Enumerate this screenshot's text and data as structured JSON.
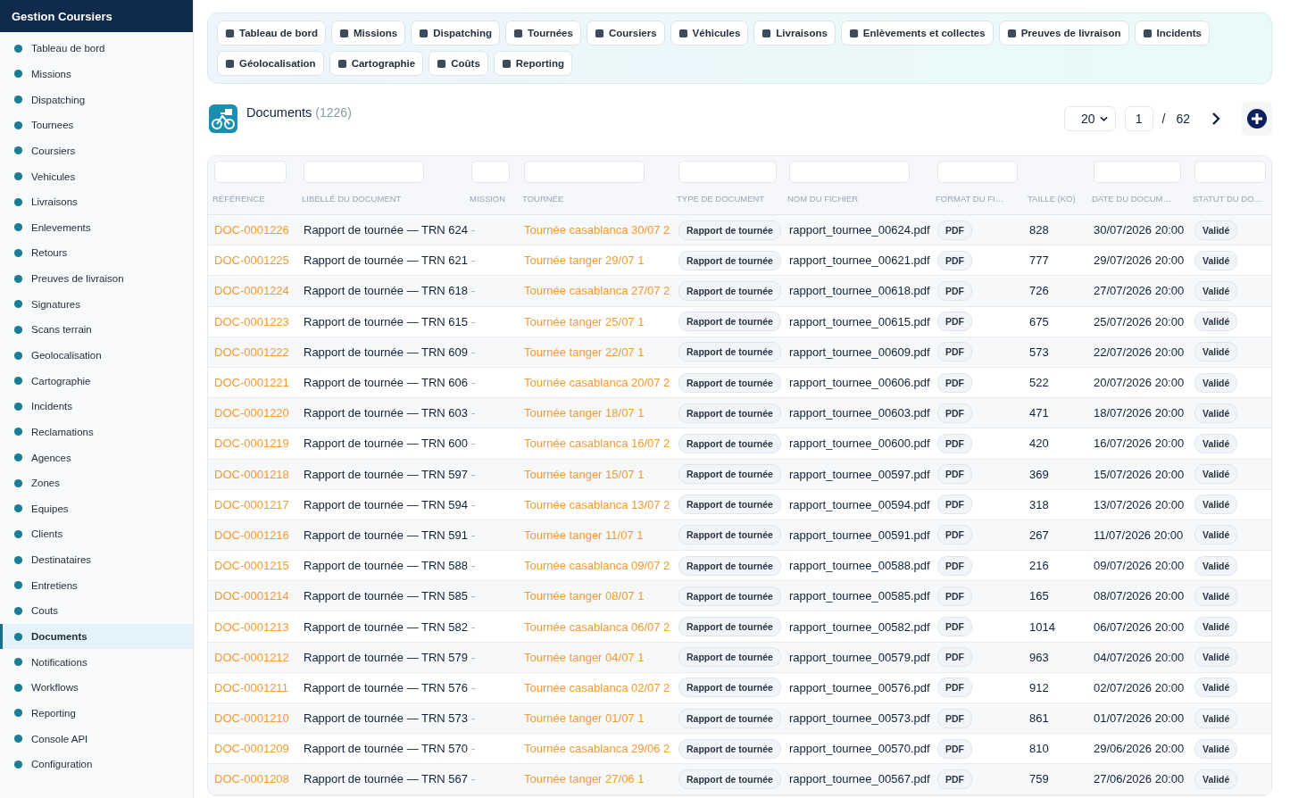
{
  "sidebar": {
    "title": "Gestion Coursiers",
    "items": [
      {
        "label": "Tableau de bord",
        "selected": false
      },
      {
        "label": "Missions",
        "selected": false
      },
      {
        "label": "Dispatching",
        "selected": false
      },
      {
        "label": "Tournees",
        "selected": false
      },
      {
        "label": "Coursiers",
        "selected": false
      },
      {
        "label": "Vehicules",
        "selected": false
      },
      {
        "label": "Livraisons",
        "selected": false
      },
      {
        "label": "Enlevements",
        "selected": false
      },
      {
        "label": "Retours",
        "selected": false
      },
      {
        "label": "Preuves de livraison",
        "selected": false
      },
      {
        "label": "Signatures",
        "selected": false
      },
      {
        "label": "Scans terrain",
        "selected": false
      },
      {
        "label": "Geolocalisation",
        "selected": false
      },
      {
        "label": "Cartographie",
        "selected": false
      },
      {
        "label": "Incidents",
        "selected": false
      },
      {
        "label": "Reclamations",
        "selected": false
      },
      {
        "label": "Agences",
        "selected": false
      },
      {
        "label": "Zones",
        "selected": false
      },
      {
        "label": "Equipes",
        "selected": false
      },
      {
        "label": "Clients",
        "selected": false
      },
      {
        "label": "Destinataires",
        "selected": false
      },
      {
        "label": "Entretiens",
        "selected": false
      },
      {
        "label": "Couts",
        "selected": false
      },
      {
        "label": "Documents",
        "selected": true
      },
      {
        "label": "Notifications",
        "selected": false
      },
      {
        "label": "Workflows",
        "selected": false
      },
      {
        "label": "Reporting",
        "selected": false
      },
      {
        "label": "Console API",
        "selected": false
      },
      {
        "label": "Configuration",
        "selected": false
      }
    ]
  },
  "quick_links": [
    "Tableau de bord",
    "Missions",
    "Dispatching",
    "Tournées",
    "Coursiers",
    "Véhicules",
    "Livraisons",
    "Enlèvements et collectes",
    "Preuves de livraison",
    "Incidents",
    "Géolocalisation",
    "Cartographie",
    "Coûts",
    "Reporting"
  ],
  "header": {
    "title": "Documents",
    "count": "(1226)",
    "page_size": "20",
    "page": "1",
    "separator": "/",
    "page_count": "62"
  },
  "table": {
    "columns": [
      {
        "label": "RÉFÉRENCE",
        "filter": true,
        "kind": "link"
      },
      {
        "label": "LIBELLÉ DU DOCUMENT",
        "filter": true,
        "kind": "text"
      },
      {
        "label": "MISSION",
        "filter": true,
        "kind": "muted"
      },
      {
        "label": "TOURNÉE",
        "filter": true,
        "kind": "link"
      },
      {
        "label": "TYPE DE DOCUMENT",
        "filter": true,
        "kind": "chip"
      },
      {
        "label": "NOM DU FICHIER",
        "filter": true,
        "kind": "text"
      },
      {
        "label": "FORMAT DU FI…",
        "filter": true,
        "kind": "chip"
      },
      {
        "label": "TAILLE (KO)",
        "filter": false,
        "kind": "text"
      },
      {
        "label": "DATE DU DOCUM…",
        "filter": true,
        "kind": "text"
      },
      {
        "label": "STATUT DU DO…",
        "filter": true,
        "kind": "chip"
      }
    ],
    "rows": [
      [
        "DOC-0001226",
        "Rapport de tournée — TRN 624",
        "-",
        "Tournée casablanca 30/07 2",
        "Rapport de tournée",
        "rapport_tournee_00624.pdf",
        "PDF",
        "828",
        "30/07/2026 20:00",
        "Validé"
      ],
      [
        "DOC-0001225",
        "Rapport de tournée — TRN 621",
        "-",
        "Tournée tanger 29/07 1",
        "Rapport de tournée",
        "rapport_tournee_00621.pdf",
        "PDF",
        "777",
        "29/07/2026 20:00",
        "Validé"
      ],
      [
        "DOC-0001224",
        "Rapport de tournée — TRN 618",
        "-",
        "Tournée casablanca 27/07 2",
        "Rapport de tournée",
        "rapport_tournee_00618.pdf",
        "PDF",
        "726",
        "27/07/2026 20:00",
        "Validé"
      ],
      [
        "DOC-0001223",
        "Rapport de tournée — TRN 615",
        "-",
        "Tournée tanger 25/07 1",
        "Rapport de tournée",
        "rapport_tournee_00615.pdf",
        "PDF",
        "675",
        "25/07/2026 20:00",
        "Validé"
      ],
      [
        "DOC-0001222",
        "Rapport de tournée — TRN 609",
        "-",
        "Tournée tanger 22/07 1",
        "Rapport de tournée",
        "rapport_tournee_00609.pdf",
        "PDF",
        "573",
        "22/07/2026 20:00",
        "Validé"
      ],
      [
        "DOC-0001221",
        "Rapport de tournée — TRN 606",
        "-",
        "Tournée casablanca 20/07 2",
        "Rapport de tournée",
        "rapport_tournee_00606.pdf",
        "PDF",
        "522",
        "20/07/2026 20:00",
        "Validé"
      ],
      [
        "DOC-0001220",
        "Rapport de tournée — TRN 603",
        "-",
        "Tournée tanger 18/07 1",
        "Rapport de tournée",
        "rapport_tournee_00603.pdf",
        "PDF",
        "471",
        "18/07/2026 20:00",
        "Validé"
      ],
      [
        "DOC-0001219",
        "Rapport de tournée — TRN 600",
        "-",
        "Tournée casablanca 16/07 2",
        "Rapport de tournée",
        "rapport_tournee_00600.pdf",
        "PDF",
        "420",
        "16/07/2026 20:00",
        "Validé"
      ],
      [
        "DOC-0001218",
        "Rapport de tournée — TRN 597",
        "-",
        "Tournée tanger 15/07 1",
        "Rapport de tournée",
        "rapport_tournee_00597.pdf",
        "PDF",
        "369",
        "15/07/2026 20:00",
        "Validé"
      ],
      [
        "DOC-0001217",
        "Rapport de tournée — TRN 594",
        "-",
        "Tournée casablanca 13/07 2",
        "Rapport de tournée",
        "rapport_tournee_00594.pdf",
        "PDF",
        "318",
        "13/07/2026 20:00",
        "Validé"
      ],
      [
        "DOC-0001216",
        "Rapport de tournée — TRN 591",
        "-",
        "Tournée tanger 11/07 1",
        "Rapport de tournée",
        "rapport_tournee_00591.pdf",
        "PDF",
        "267",
        "11/07/2026 20:00",
        "Validé"
      ],
      [
        "DOC-0001215",
        "Rapport de tournée — TRN 588",
        "-",
        "Tournée casablanca 09/07 2",
        "Rapport de tournée",
        "rapport_tournee_00588.pdf",
        "PDF",
        "216",
        "09/07/2026 20:00",
        "Validé"
      ],
      [
        "DOC-0001214",
        "Rapport de tournée — TRN 585",
        "-",
        "Tournée tanger 08/07 1",
        "Rapport de tournée",
        "rapport_tournee_00585.pdf",
        "PDF",
        "165",
        "08/07/2026 20:00",
        "Validé"
      ],
      [
        "DOC-0001213",
        "Rapport de tournée — TRN 582",
        "-",
        "Tournée casablanca 06/07 2",
        "Rapport de tournée",
        "rapport_tournee_00582.pdf",
        "PDF",
        "1014",
        "06/07/2026 20:00",
        "Validé"
      ],
      [
        "DOC-0001212",
        "Rapport de tournée — TRN 579",
        "-",
        "Tournée tanger 04/07 1",
        "Rapport de tournée",
        "rapport_tournee_00579.pdf",
        "PDF",
        "963",
        "04/07/2026 20:00",
        "Validé"
      ],
      [
        "DOC-0001211",
        "Rapport de tournée — TRN 576",
        "-",
        "Tournée casablanca 02/07 2",
        "Rapport de tournée",
        "rapport_tournee_00576.pdf",
        "PDF",
        "912",
        "02/07/2026 20:00",
        "Validé"
      ],
      [
        "DOC-0001210",
        "Rapport de tournée — TRN 573",
        "-",
        "Tournée tanger 01/07 1",
        "Rapport de tournée",
        "rapport_tournee_00573.pdf",
        "PDF",
        "861",
        "01/07/2026 20:00",
        "Validé"
      ],
      [
        "DOC-0001209",
        "Rapport de tournée — TRN 570",
        "-",
        "Tournée casablanca 29/06 2",
        "Rapport de tournée",
        "rapport_tournee_00570.pdf",
        "PDF",
        "810",
        "29/06/2026 20:00",
        "Validé"
      ],
      [
        "DOC-0001208",
        "Rapport de tournée — TRN 567",
        "-",
        "Tournée tanger 27/06 1",
        "Rapport de tournée",
        "rapport_tournee_00567.pdf",
        "PDF",
        "759",
        "27/06/2026 20:00",
        "Validé"
      ]
    ]
  }
}
